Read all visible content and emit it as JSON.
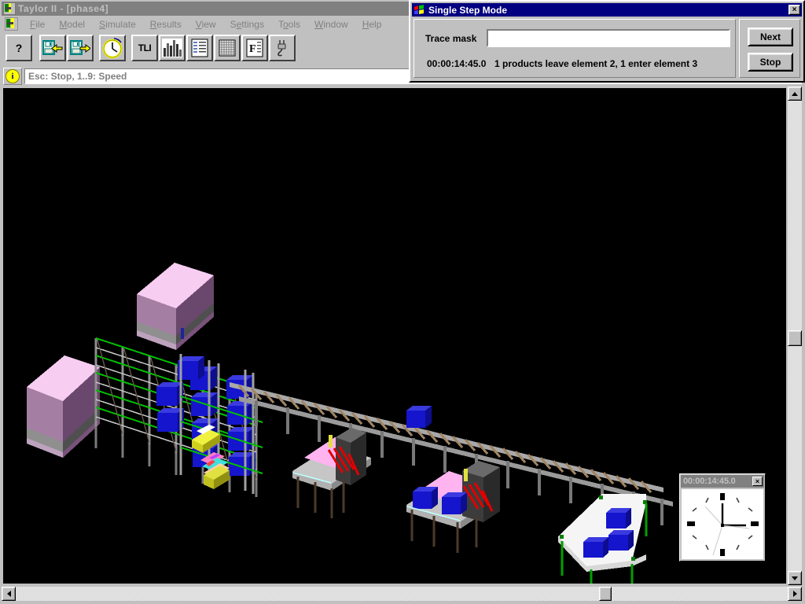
{
  "window": {
    "title": "Taylor II - [phase4]",
    "icon": "taylor-app-icon"
  },
  "menu": {
    "items": [
      {
        "label": "File",
        "mnemonic": "F"
      },
      {
        "label": "Model",
        "mnemonic": "M"
      },
      {
        "label": "Simulate",
        "mnemonic": "S"
      },
      {
        "label": "Results",
        "mnemonic": "R"
      },
      {
        "label": "View",
        "mnemonic": "V"
      },
      {
        "label": "Settings",
        "mnemonic": "e"
      },
      {
        "label": "Tools",
        "mnemonic": "o"
      },
      {
        "label": "Window",
        "mnemonic": "W"
      },
      {
        "label": "Help",
        "mnemonic": "H"
      }
    ]
  },
  "toolbar": {
    "buttons": [
      {
        "name": "help-button",
        "icon": "question-mark-icon",
        "label": "?"
      },
      {
        "name": "load-model-button",
        "icon": "floppy-load-icon",
        "label": ""
      },
      {
        "name": "save-model-button",
        "icon": "floppy-save-icon",
        "label": ""
      },
      {
        "name": "clock-button",
        "icon": "clock-icon",
        "label": ""
      },
      {
        "name": "tli-button",
        "icon": "tli-icon",
        "label": "TLI"
      },
      {
        "name": "bar-chart-button",
        "icon": "bar-chart-icon",
        "label": ""
      },
      {
        "name": "report-button",
        "icon": "report-list-icon",
        "label": ""
      },
      {
        "name": "table-button",
        "icon": "grid-table-icon",
        "label": ""
      },
      {
        "name": "font-button",
        "icon": "font-f-icon",
        "label": "F"
      },
      {
        "name": "plug-button",
        "icon": "plug-icon",
        "label": ""
      }
    ]
  },
  "statusbar": {
    "info_icon": "info-icon",
    "info_glyph": "i",
    "message": "Esc: Stop, 1..9: Speed"
  },
  "dialog": {
    "title": "Single Step Mode",
    "icon": "windows-flag-icon",
    "close_label": "×",
    "trace_label": "Trace mask",
    "trace_value": "",
    "trace_placeholder": "",
    "time": "00:00:14:45.0",
    "message": "1 products leave element 2, 1 enter element 3",
    "buttons": {
      "next": "Next",
      "stop": "Stop"
    }
  },
  "clock_widget": {
    "time": "00:00:14:45.0",
    "close_label": "×",
    "hour_angle": 165,
    "minute_angle": 90,
    "second_angle": 200
  },
  "scrollbars": {
    "vertical": {
      "up_arrow": "scroll-up-arrow",
      "down_arrow": "scroll-down-arrow",
      "thumb_position_pct": 50
    },
    "horizontal": {
      "left_arrow": "scroll-left-arrow",
      "right_arrow": "scroll-right-arrow",
      "thumb_position_pct": 75
    }
  },
  "scene": {
    "description": "3D simulation view of a warehouse: high-bay storage rack with blue pallets, two large pink storage blocks, a long roller conveyor, two pink-topped workstations and a white output table with blue boxes",
    "background": "#000000",
    "colors": {
      "rack_frame": "#9a9a9a",
      "rack_beam_green": "#00c000",
      "pallet_blue": "#1414c8",
      "block_pink_top": "#f5c8f0",
      "block_pink_left": "#a87ea8",
      "block_pink_right": "#6e4a6e",
      "block_gray_band": "#585858",
      "conveyor_roller": "#a08464",
      "conveyor_rail": "#8c8c8c",
      "machine_top_pink": "#ffb4f0",
      "machine_body_gray": "#b4b4b4",
      "machine_dark_gray": "#3c3c3c",
      "machine_red_rollers": "#e00000",
      "table_white": "#f5f5f5",
      "table_leg_green": "#008000",
      "agv_yellow": "#e0e000"
    }
  }
}
